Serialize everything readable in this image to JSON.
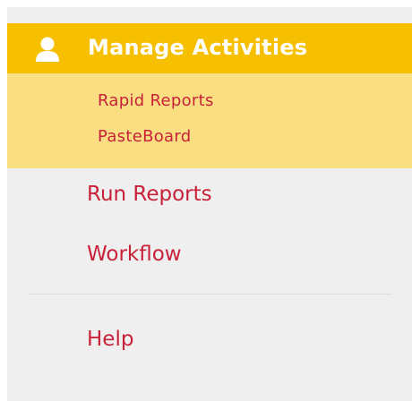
{
  "menu": {
    "header": {
      "label": "Manage Activities",
      "icon": "user-icon",
      "background": "#f6bf00"
    },
    "submenu": {
      "background": "#fadf82",
      "items": [
        {
          "label": "Rapid Reports"
        },
        {
          "label": "PasteBoard"
        }
      ]
    },
    "items": [
      {
        "label": "Run Reports"
      },
      {
        "label": "Workflow"
      }
    ],
    "footer_items": [
      {
        "label": "Help"
      }
    ],
    "link_color": "#c8213a",
    "panel_background": "#efefef"
  }
}
